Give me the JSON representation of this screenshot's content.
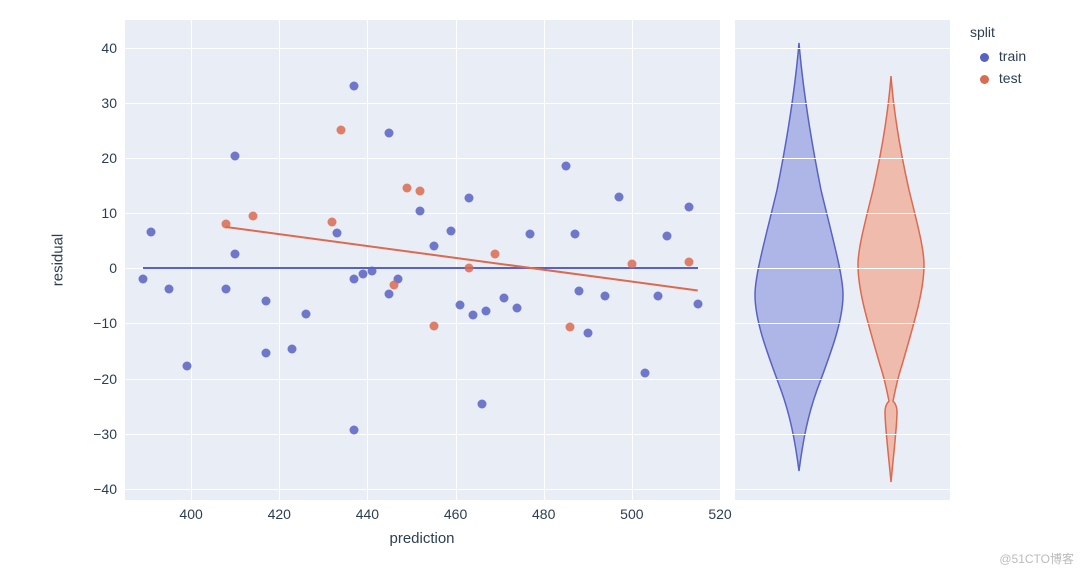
{
  "chart_data": [
    {
      "type": "scatter",
      "xlabel": "prediction",
      "ylabel": "residual",
      "xlim": [
        385,
        520
      ],
      "ylim": [
        -42,
        45
      ],
      "xticks": [
        400,
        420,
        440,
        460,
        480,
        500,
        520
      ],
      "yticks": [
        -40,
        -30,
        -20,
        -10,
        0,
        10,
        20,
        30,
        40
      ],
      "regression_lines": {
        "train": {
          "x1": 389,
          "y1": 0,
          "x2": 515,
          "y2": 0
        },
        "test": {
          "x1": 408,
          "y1": 7.5,
          "x2": 515,
          "y2": -4.0
        }
      },
      "series": [
        {
          "name": "train",
          "color": "#5862c2",
          "points": [
            {
              "x": 389,
              "y": -2
            },
            {
              "x": 391,
              "y": 6.5
            },
            {
              "x": 395,
              "y": -3.7
            },
            {
              "x": 399,
              "y": -17.8
            },
            {
              "x": 408,
              "y": -3.7
            },
            {
              "x": 410,
              "y": 20.3
            },
            {
              "x": 410,
              "y": 2.5
            },
            {
              "x": 417,
              "y": -15.4
            },
            {
              "x": 417,
              "y": -6
            },
            {
              "x": 423,
              "y": -14.6
            },
            {
              "x": 426,
              "y": -8.3
            },
            {
              "x": 433,
              "y": 6.4
            },
            {
              "x": 437,
              "y": 33.1
            },
            {
              "x": 437,
              "y": -29.3
            },
            {
              "x": 437,
              "y": -1.9
            },
            {
              "x": 439,
              "y": -1
            },
            {
              "x": 441,
              "y": -0.5
            },
            {
              "x": 445,
              "y": 24.6
            },
            {
              "x": 445,
              "y": -4.6
            },
            {
              "x": 447,
              "y": -2.0
            },
            {
              "x": 452,
              "y": 10.3
            },
            {
              "x": 455,
              "y": 4.0
            },
            {
              "x": 459,
              "y": 6.8
            },
            {
              "x": 461,
              "y": -6.7
            },
            {
              "x": 463,
              "y": 12.8
            },
            {
              "x": 464,
              "y": -8.4
            },
            {
              "x": 466,
              "y": -24.6
            },
            {
              "x": 467,
              "y": -7.8
            },
            {
              "x": 471,
              "y": -5.3
            },
            {
              "x": 474,
              "y": -7.2
            },
            {
              "x": 477,
              "y": 6.3
            },
            {
              "x": 485,
              "y": 18.5
            },
            {
              "x": 487,
              "y": 6.2
            },
            {
              "x": 488,
              "y": -4.2
            },
            {
              "x": 490,
              "y": -11.8
            },
            {
              "x": 494,
              "y": -5.1
            },
            {
              "x": 497,
              "y": 13.0
            },
            {
              "x": 503,
              "y": -19.0
            },
            {
              "x": 506,
              "y": -5.0
            },
            {
              "x": 508,
              "y": 5.8
            },
            {
              "x": 513,
              "y": 11.1
            },
            {
              "x": 515,
              "y": -6.5
            }
          ]
        },
        {
          "name": "test",
          "color": "#da6a50",
          "points": [
            {
              "x": 408,
              "y": 8.1
            },
            {
              "x": 414,
              "y": 9.4
            },
            {
              "x": 432,
              "y": 8.4
            },
            {
              "x": 434,
              "y": 25.1
            },
            {
              "x": 446,
              "y": -3.1
            },
            {
              "x": 449,
              "y": 14.5
            },
            {
              "x": 452,
              "y": 14.0
            },
            {
              "x": 455,
              "y": -10.4
            },
            {
              "x": 463,
              "y": 0.0
            },
            {
              "x": 469,
              "y": 2.6
            },
            {
              "x": 486,
              "y": -10.7
            },
            {
              "x": 500,
              "y": 0.8
            },
            {
              "x": 513,
              "y": 1.2
            }
          ]
        }
      ]
    },
    {
      "type": "violin",
      "ylim": [
        -42,
        45
      ],
      "categories": [
        "train",
        "test"
      ],
      "series": [
        {
          "name": "train",
          "color": "#5862c2",
          "fill": "#9aa3e3",
          "min": -35,
          "max": 43,
          "mode": -4,
          "spread": 1.0
        },
        {
          "name": "test",
          "color": "#da6a50",
          "fill": "#f0a993",
          "min": -41,
          "max": 37,
          "mode": 5,
          "spread": 0.7,
          "neck": -29
        }
      ]
    }
  ],
  "legend": {
    "title": "split",
    "items": [
      {
        "label": "train",
        "color": "#5862c2"
      },
      {
        "label": "test",
        "color": "#da6a50"
      }
    ]
  },
  "watermark": "@51CTO博客"
}
